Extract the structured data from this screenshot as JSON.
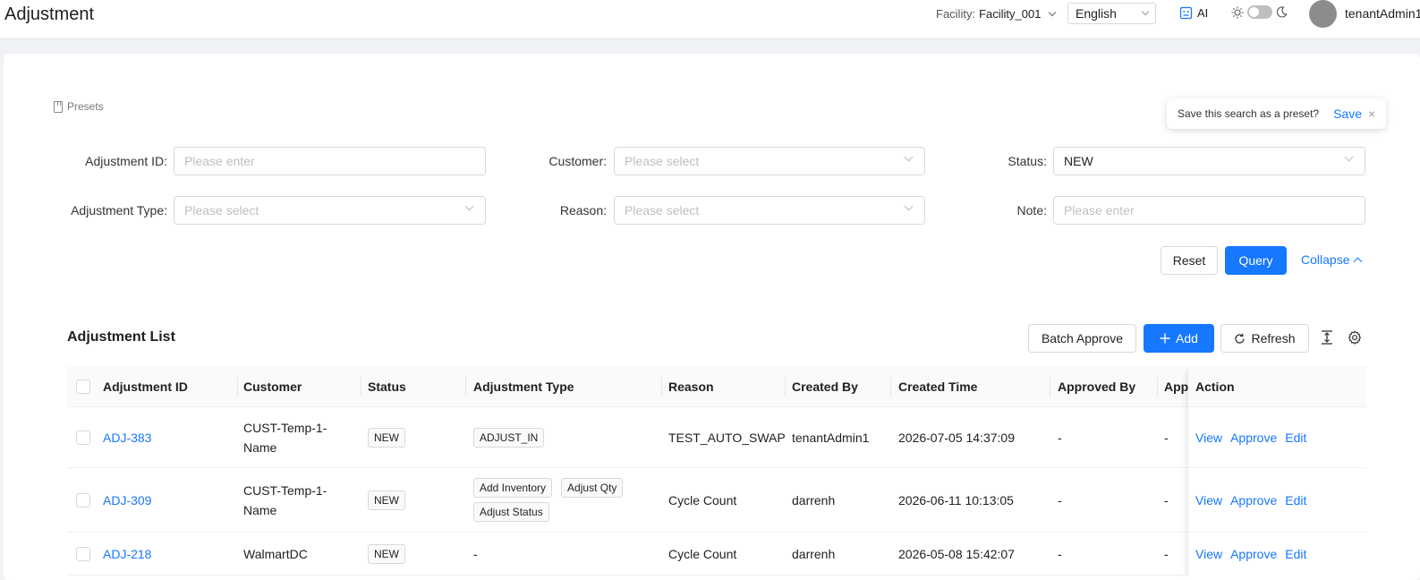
{
  "header": {
    "title": "Adjustment",
    "facility_label": "Facility:",
    "facility_value": "Facility_001",
    "language": "English",
    "ai_label": "AI",
    "user_name": "tenantAdmin1"
  },
  "presets": {
    "label": "Presets",
    "popover_text": "Save this search as a preset?",
    "save_label": "Save",
    "close_glyph": "×"
  },
  "filters": {
    "adjustment_id": {
      "label": "Adjustment ID:",
      "placeholder": "Please enter"
    },
    "customer": {
      "label": "Customer:",
      "placeholder": "Please select"
    },
    "status": {
      "label": "Status:",
      "value": "NEW"
    },
    "adjustment_type": {
      "label": "Adjustment Type:",
      "placeholder": "Please select"
    },
    "reason": {
      "label": "Reason:",
      "placeholder": "Please select"
    },
    "note": {
      "label": "Note:",
      "placeholder": "Please enter"
    },
    "reset_label": "Reset",
    "query_label": "Query",
    "collapse_label": "Collapse"
  },
  "list": {
    "title": "Adjustment List",
    "batch_approve_label": "Batch Approve",
    "add_label": "Add",
    "refresh_label": "Refresh"
  },
  "table": {
    "columns": [
      "Adjustment ID",
      "Customer",
      "Status",
      "Adjustment Type",
      "Reason",
      "Created By",
      "Created Time",
      "Approved By",
      "Approved Time",
      "Action"
    ],
    "actions": [
      "View",
      "Approve",
      "Edit"
    ],
    "rows": [
      {
        "id": "ADJ-383",
        "customer": "CUST-Temp-1-Name",
        "status": "NEW",
        "types": [
          "ADJUST_IN"
        ],
        "reason": "TEST_AUTO_SWAP",
        "created_by": "tenantAdmin1",
        "created_time": "2026-07-05 14:37:09",
        "approved_by": "-",
        "approved_time": "-"
      },
      {
        "id": "ADJ-309",
        "customer": "CUST-Temp-1-Name",
        "status": "NEW",
        "types": [
          "Add Inventory",
          "Adjust Qty",
          "Adjust Status"
        ],
        "reason": "Cycle Count",
        "created_by": "darrenh",
        "created_time": "2026-06-11 10:13:05",
        "approved_by": "-",
        "approved_time": "-"
      },
      {
        "id": "ADJ-218",
        "customer": "WalmartDC",
        "status": "NEW",
        "types": [],
        "types_empty": "-",
        "reason": "Cycle Count",
        "created_by": "darrenh",
        "created_time": "2026-05-08 15:42:07",
        "approved_by": "-",
        "approved_time": "-"
      }
    ]
  }
}
